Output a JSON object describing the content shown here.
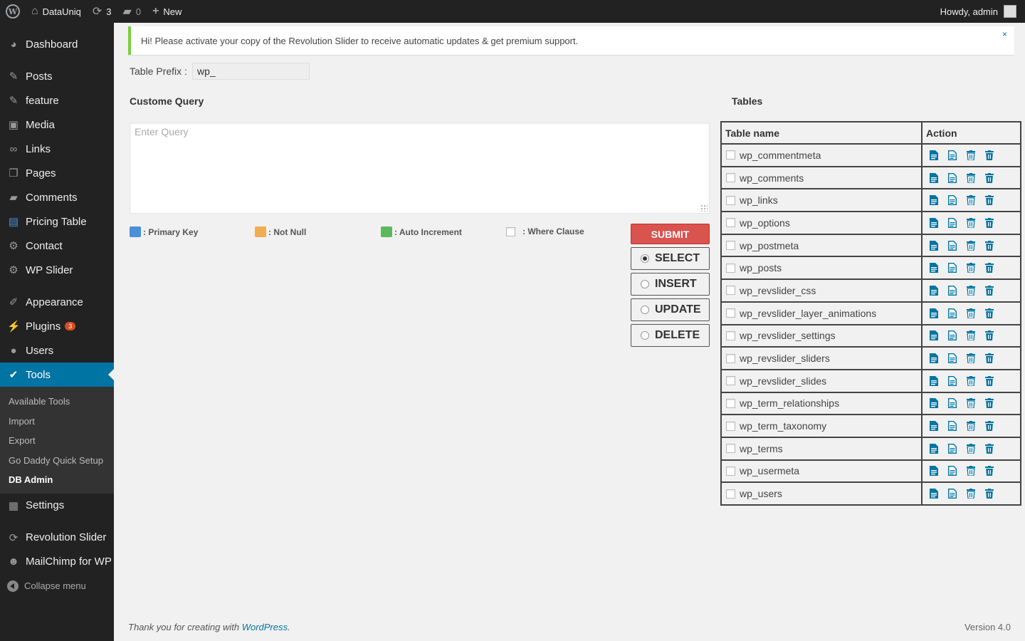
{
  "adminbar": {
    "site_name": "DataUniq",
    "updates_count": "3",
    "comments_count": "0",
    "new_label": "New",
    "howdy": "Howdy, admin"
  },
  "sidebar": {
    "items": [
      {
        "label": "Dashboard",
        "icon": "dashboard-icon"
      },
      {
        "label": "Posts",
        "icon": "pin-icon"
      },
      {
        "label": "feature",
        "icon": "pin-icon"
      },
      {
        "label": "Media",
        "icon": "media-icon"
      },
      {
        "label": "Links",
        "icon": "link-icon"
      },
      {
        "label": "Pages",
        "icon": "pages-icon"
      },
      {
        "label": "Comments",
        "icon": "comment-icon"
      },
      {
        "label": "Pricing Table",
        "icon": "table-icon"
      },
      {
        "label": "Contact",
        "icon": "gear-icon"
      },
      {
        "label": "WP Slider",
        "icon": "gear-icon"
      },
      {
        "label": "Appearance",
        "icon": "brush-icon"
      },
      {
        "label": "Plugins",
        "icon": "plugin-icon",
        "badge": "3"
      },
      {
        "label": "Users",
        "icon": "user-icon"
      },
      {
        "label": "Tools",
        "icon": "wrench-icon"
      },
      {
        "label": "Settings",
        "icon": "settings-icon"
      },
      {
        "label": "Revolution Slider",
        "icon": "refresh-icon"
      },
      {
        "label": "MailChimp for WP",
        "icon": "mailchimp-icon"
      }
    ],
    "submenu": [
      "Available Tools",
      "Import",
      "Export",
      "Go Daddy Quick Setup",
      "DB Admin"
    ],
    "collapse": "Collapse menu"
  },
  "notice": {
    "text": "Hi! Please activate your copy of the Revolution Slider to receive automatic updates & get premium support.",
    "dismiss": "×"
  },
  "prefix": {
    "label": "Table Prefix :",
    "value": "wp_"
  },
  "query": {
    "heading": "Custome Query",
    "placeholder": "Enter Query"
  },
  "legend": {
    "primary_key": ": Primary Key",
    "not_null": ": Not Null",
    "auto_increment": ": Auto Increment",
    "where_clause": ": Where Clause"
  },
  "colors": {
    "primary_key": "#4a8fd8",
    "not_null": "#f0ad4e",
    "auto_increment": "#5cb85c",
    "submit": "#d9534f",
    "action_icon": "#0074a2"
  },
  "buttons": {
    "submit": "SUBMIT",
    "select": "SELECT",
    "insert": "INSERT",
    "update": "UPDATE",
    "delete": "DELETE"
  },
  "tables": {
    "heading": "Tables",
    "col_name": "Table name",
    "col_action": "Action",
    "rows": [
      "wp_commentmeta",
      "wp_comments",
      "wp_links",
      "wp_options",
      "wp_postmeta",
      "wp_posts",
      "wp_revslider_css",
      "wp_revslider_layer_animations",
      "wp_revslider_settings",
      "wp_revslider_sliders",
      "wp_revslider_slides",
      "wp_term_relationships",
      "wp_term_taxonomy",
      "wp_terms",
      "wp_usermeta",
      "wp_users"
    ]
  },
  "footer": {
    "thanks": "Thank you for creating with ",
    "link": "WordPress",
    "period": ".",
    "version": "Version 4.0"
  }
}
